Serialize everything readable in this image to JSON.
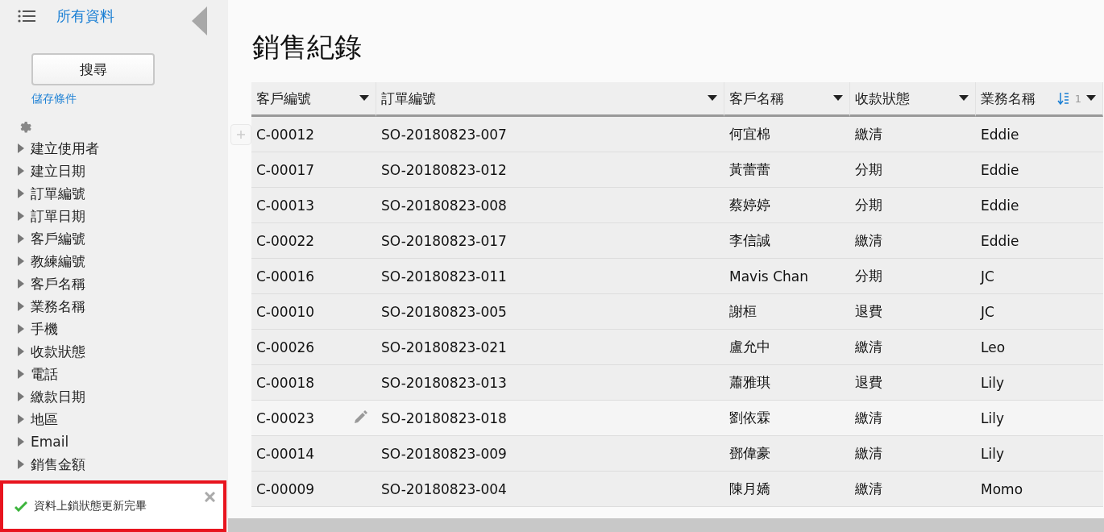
{
  "sidebar": {
    "title": "所有資料",
    "search_button": "搜尋",
    "save_link": "儲存條件",
    "fields": [
      "建立使用者",
      "建立日期",
      "訂單編號",
      "訂單日期",
      "客戶編號",
      "教練編號",
      "客戶名稱",
      "業務名稱",
      "手機",
      "收款狀態",
      "電話",
      "繳款日期",
      "地區",
      "Email",
      "銷售金額"
    ]
  },
  "toast": {
    "message": "資料上鎖狀態更新完畢",
    "highlighted": true
  },
  "page_title": "銷售紀錄",
  "table": {
    "columns": [
      {
        "label": "客戶編號",
        "sorted": false
      },
      {
        "label": "訂單編號",
        "sorted": false
      },
      {
        "label": "客戶名稱",
        "sorted": false
      },
      {
        "label": "收款狀態",
        "sorted": false
      },
      {
        "label": "業務名稱",
        "sorted": true,
        "sort_order": "1"
      }
    ],
    "rows": [
      {
        "cells": [
          "C-00012",
          "SO-20180823-007",
          "何宜棉",
          "繳清",
          "Eddie"
        ],
        "hovered": false
      },
      {
        "cells": [
          "C-00017",
          "SO-20180823-012",
          "黃蕾蕾",
          "分期",
          "Eddie"
        ],
        "hovered": false
      },
      {
        "cells": [
          "C-00013",
          "SO-20180823-008",
          "蔡婷婷",
          "分期",
          "Eddie"
        ],
        "hovered": false
      },
      {
        "cells": [
          "C-00022",
          "SO-20180823-017",
          "李信誠",
          "繳清",
          "Eddie"
        ],
        "hovered": false
      },
      {
        "cells": [
          "C-00016",
          "SO-20180823-011",
          "Mavis Chan",
          "分期",
          "JC"
        ],
        "hovered": false
      },
      {
        "cells": [
          "C-00010",
          "SO-20180823-005",
          "謝桓",
          "退費",
          "JC"
        ],
        "hovered": false
      },
      {
        "cells": [
          "C-00026",
          "SO-20180823-021",
          "盧允中",
          "繳清",
          "Leo"
        ],
        "hovered": false
      },
      {
        "cells": [
          "C-00018",
          "SO-20180823-013",
          "蕭雅琪",
          "退費",
          "Lily"
        ],
        "hovered": false
      },
      {
        "cells": [
          "C-00023",
          "SO-20180823-018",
          "劉依霖",
          "繳清",
          "Lily"
        ],
        "hovered": true
      },
      {
        "cells": [
          "C-00014",
          "SO-20180823-009",
          "鄧偉豪",
          "繳清",
          "Lily"
        ],
        "hovered": false
      },
      {
        "cells": [
          "C-00009",
          "SO-20180823-004",
          "陳月嬌",
          "繳清",
          "Momo"
        ],
        "hovered": false
      }
    ]
  }
}
